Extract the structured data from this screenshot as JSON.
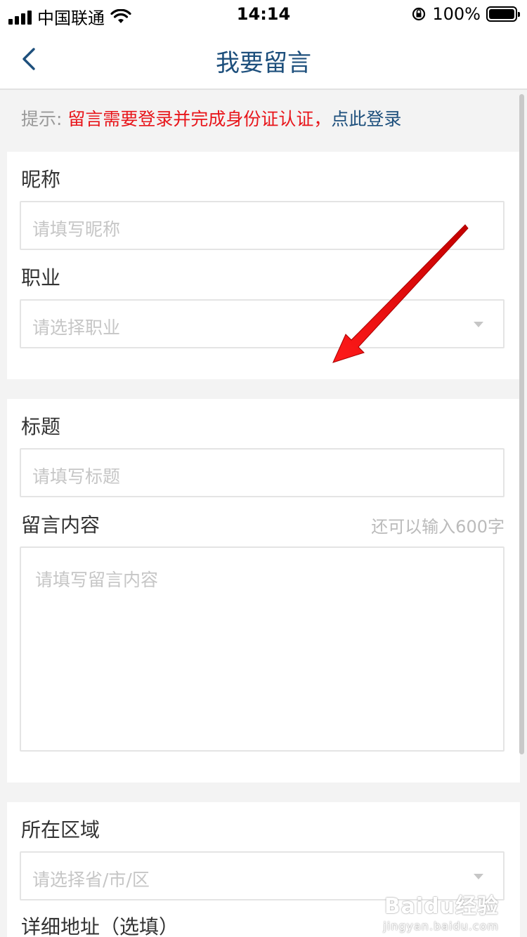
{
  "status_bar": {
    "carrier": "中国联通",
    "time": "14:14",
    "battery": "100%"
  },
  "header": {
    "title": "我要留言"
  },
  "tip": {
    "prefix": "提示:",
    "message": "留言需要登录并完成身份证认证，",
    "link": "点此登录"
  },
  "form": {
    "nickname": {
      "label": "昵称",
      "placeholder": "请填写昵称"
    },
    "occupation": {
      "label": "职业",
      "placeholder": "请选择职业"
    },
    "subject": {
      "label": "标题",
      "placeholder": "请填写标题"
    },
    "content": {
      "label": "留言内容",
      "counter": "还可以输入600字",
      "placeholder": "请填写留言内容"
    },
    "region": {
      "label": "所在区域",
      "placeholder": "请选择省/市/区"
    },
    "address": {
      "label": "详细地址（选填）"
    }
  },
  "watermark": {
    "brand": "Baidu经验",
    "url": "jingyan.baidu.com"
  },
  "colors": {
    "title": "#1d4f7c",
    "warning": "#e8161b",
    "annotation_arrow": "#e8161b"
  }
}
